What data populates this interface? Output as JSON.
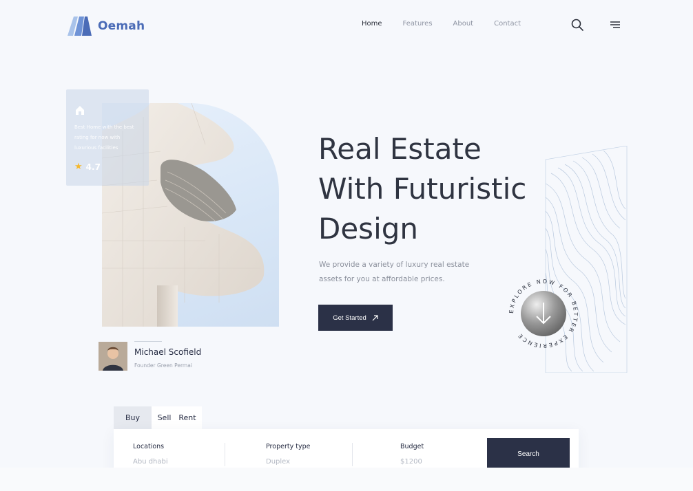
{
  "brand": {
    "name": "Oemah",
    "colors": {
      "primary": "#2b3147",
      "accent": "#4b6cb7"
    }
  },
  "nav": {
    "items": [
      "Home",
      "Features",
      "About",
      "Contact"
    ],
    "active": "Home"
  },
  "header_icons": [
    "search-icon",
    "menu-icon"
  ],
  "hero_card": {
    "text": "Best Home with the best rating for now with luxurious facilities",
    "rating": "4.7",
    "icons": [
      "home-icon",
      "star-icon"
    ]
  },
  "person": {
    "name": "Michael Scofield",
    "role": "Founder Green Permai"
  },
  "hero": {
    "title_line1": "Real Estate",
    "title_line2": "With Futuristic",
    "title_line3": "Design",
    "description": "We provide a variety of luxury real estate assets for you at affordable prices.",
    "cta_label": "Get Started",
    "cta_icon": "arrow-up-right-icon"
  },
  "badge": {
    "circle_text": "EXPLORE NOW FOR BETTER EXPERIENCE",
    "icon": "arrow-down-icon"
  },
  "search": {
    "tabs": [
      "Buy",
      "Sell",
      "Rent"
    ],
    "active_tab": "Buy",
    "fields": [
      {
        "label": "Locations",
        "value": "Abu dhabi"
      },
      {
        "label": "Property type",
        "value": "Duplex"
      },
      {
        "label": "Budget",
        "value": "$1200"
      }
    ],
    "button_label": "Search"
  }
}
